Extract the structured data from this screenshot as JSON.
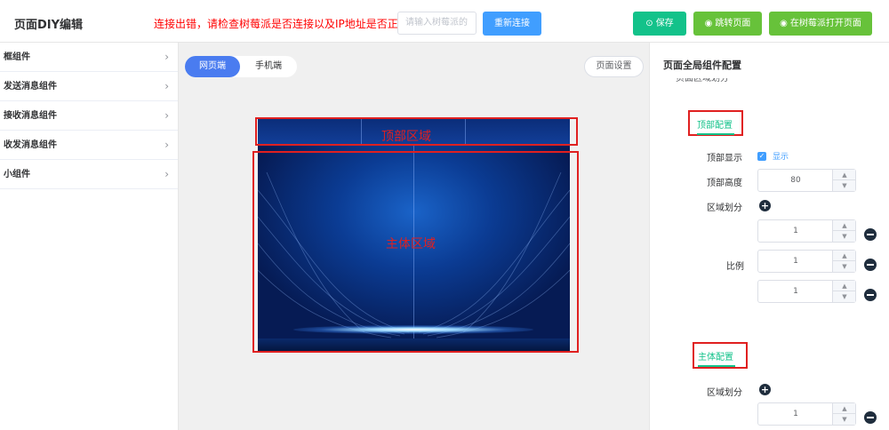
{
  "header": {
    "title": "页面DIY编辑",
    "error_message": "连接出错，请检查树莓派是否连接以及IP地址是否正确!",
    "ip_placeholder": "请输入树莓派的",
    "reconnect_label": "重新连接",
    "save_label": "保存",
    "jump_label": "跳转页面",
    "open_pi_label": "在树莓派打开页面"
  },
  "sidebar": {
    "items": [
      {
        "label": "框组件"
      },
      {
        "label": "发送消息组件"
      },
      {
        "label": "接收消息组件"
      },
      {
        "label": "收发消息组件"
      },
      {
        "label": "小组件"
      }
    ]
  },
  "center": {
    "tab_web": "网页端",
    "tab_mobile": "手机端",
    "page_settings": "页面设置",
    "top_area_label": "顶部区域",
    "main_area_label": "主体区域"
  },
  "right_panel": {
    "title": "页面全局组件配置",
    "clipped_label": "页面区域划分",
    "top_config": {
      "heading": "顶部配置",
      "show_label": "顶部显示",
      "show_checked": true,
      "show_text": "显示",
      "height_label": "顶部高度",
      "height_value": "80",
      "divide_label": "区域划分",
      "ratio_label": "比例",
      "ratios": [
        "1",
        "1",
        "1"
      ]
    },
    "main_config": {
      "heading": "主体配置",
      "divide_label": "区域划分",
      "ratios": [
        "1"
      ]
    }
  },
  "colors": {
    "primary_blue": "#409eff",
    "green": "#13c28a",
    "lime": "#67c23a",
    "annotation_red": "#e02020",
    "tab_active": "#4a7cf0"
  }
}
